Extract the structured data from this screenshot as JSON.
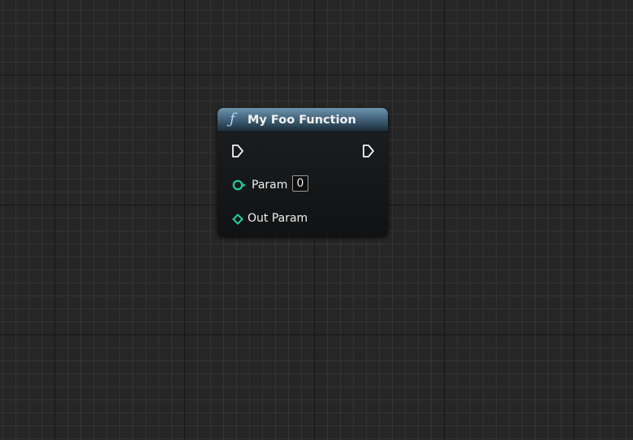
{
  "node": {
    "icon": "function-icon",
    "title": "My Foo Function",
    "header_color": "#4d6f88",
    "exec_in_icon": "exec-pin-icon",
    "exec_out_icon": "exec-pin-icon",
    "inputs": [
      {
        "label": "Param",
        "value": "0",
        "pin_icon": "integer-pin-icon",
        "pin_color": "#1fd2a2"
      }
    ],
    "outputs": [
      {
        "label": "Out Param",
        "pin_icon": "reference-pin-icon",
        "pin_color": "#1fd2a2"
      }
    ]
  }
}
